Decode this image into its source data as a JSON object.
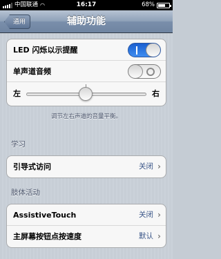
{
  "status_bar": {
    "carrier": "中国联通",
    "time": "16:17",
    "battery": "68%",
    "battery_level": 0.68,
    "signal_bars": 4
  },
  "nav": {
    "back_label": "通用",
    "title": "辅助功能"
  },
  "hearing": {
    "led_flash_label": "LED 闪烁以示提醒",
    "led_flash_on": true,
    "mono_audio_label": "单声道音频",
    "mono_audio_on": false,
    "balance_left_label": "左",
    "balance_right_label": "右",
    "balance_value": 0.5,
    "balance_note": "调节左右声道的音量平衡。"
  },
  "learning": {
    "header": "学习",
    "guided_access_label": "引导式访问",
    "guided_access_value": "关闭"
  },
  "physical": {
    "header": "肢体活动",
    "assistive_touch_label": "AssistiveTouch",
    "assistive_touch_value": "关闭",
    "home_click_speed_label": "主屏幕按钮点按速度",
    "home_click_speed_value": "默认"
  }
}
